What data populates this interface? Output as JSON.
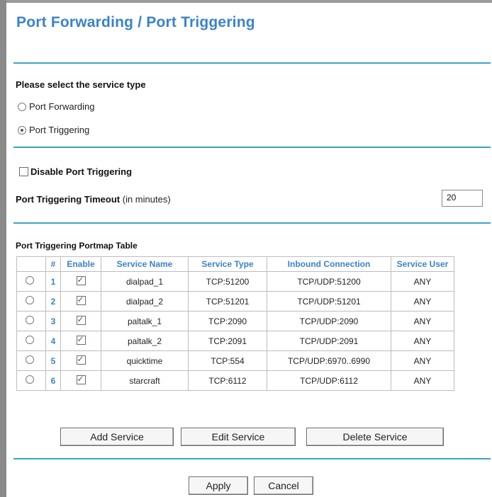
{
  "page": {
    "title": "Port Forwarding / Port Triggering"
  },
  "service_type": {
    "heading": "Please select the service type",
    "options": [
      "Port Forwarding",
      "Port Triggering"
    ],
    "selected": "Port Triggering"
  },
  "disable_triggering": {
    "label": "Disable Port Triggering",
    "checked": false
  },
  "timeout": {
    "label_bold": "Port Triggering Timeout",
    "label_unit": "(in minutes)",
    "value": "20"
  },
  "portmap": {
    "heading": "Port Triggering Portmap Table",
    "columns": [
      "",
      "#",
      "Enable",
      "Service Name",
      "Service Type",
      "Inbound Connection",
      "Service User"
    ],
    "rows": [
      {
        "num": "1",
        "enabled": true,
        "name": "dialpad_1",
        "type": "TCP:51200",
        "inbound": "TCP/UDP:51200",
        "user": "ANY"
      },
      {
        "num": "2",
        "enabled": true,
        "name": "dialpad_2",
        "type": "TCP:51201",
        "inbound": "TCP/UDP:51201",
        "user": "ANY"
      },
      {
        "num": "3",
        "enabled": true,
        "name": "paltalk_1",
        "type": "TCP:2090",
        "inbound": "TCP/UDP:2090",
        "user": "ANY"
      },
      {
        "num": "4",
        "enabled": true,
        "name": "paltalk_2",
        "type": "TCP:2091",
        "inbound": "TCP/UDP:2091",
        "user": "ANY"
      },
      {
        "num": "5",
        "enabled": true,
        "name": "quicktime",
        "type": "TCP:554",
        "inbound": "TCP/UDP:6970..6990",
        "user": "ANY"
      },
      {
        "num": "6",
        "enabled": true,
        "name": "starcraft",
        "type": "TCP:6112",
        "inbound": "TCP/UDP:6112",
        "user": "ANY"
      }
    ]
  },
  "buttons": {
    "add": "Add Service",
    "edit": "Edit Service",
    "delete": "Delete Service",
    "apply": "Apply",
    "cancel": "Cancel"
  },
  "colors": {
    "accent": "#3a83c9",
    "rule": "#3aa3c4"
  }
}
